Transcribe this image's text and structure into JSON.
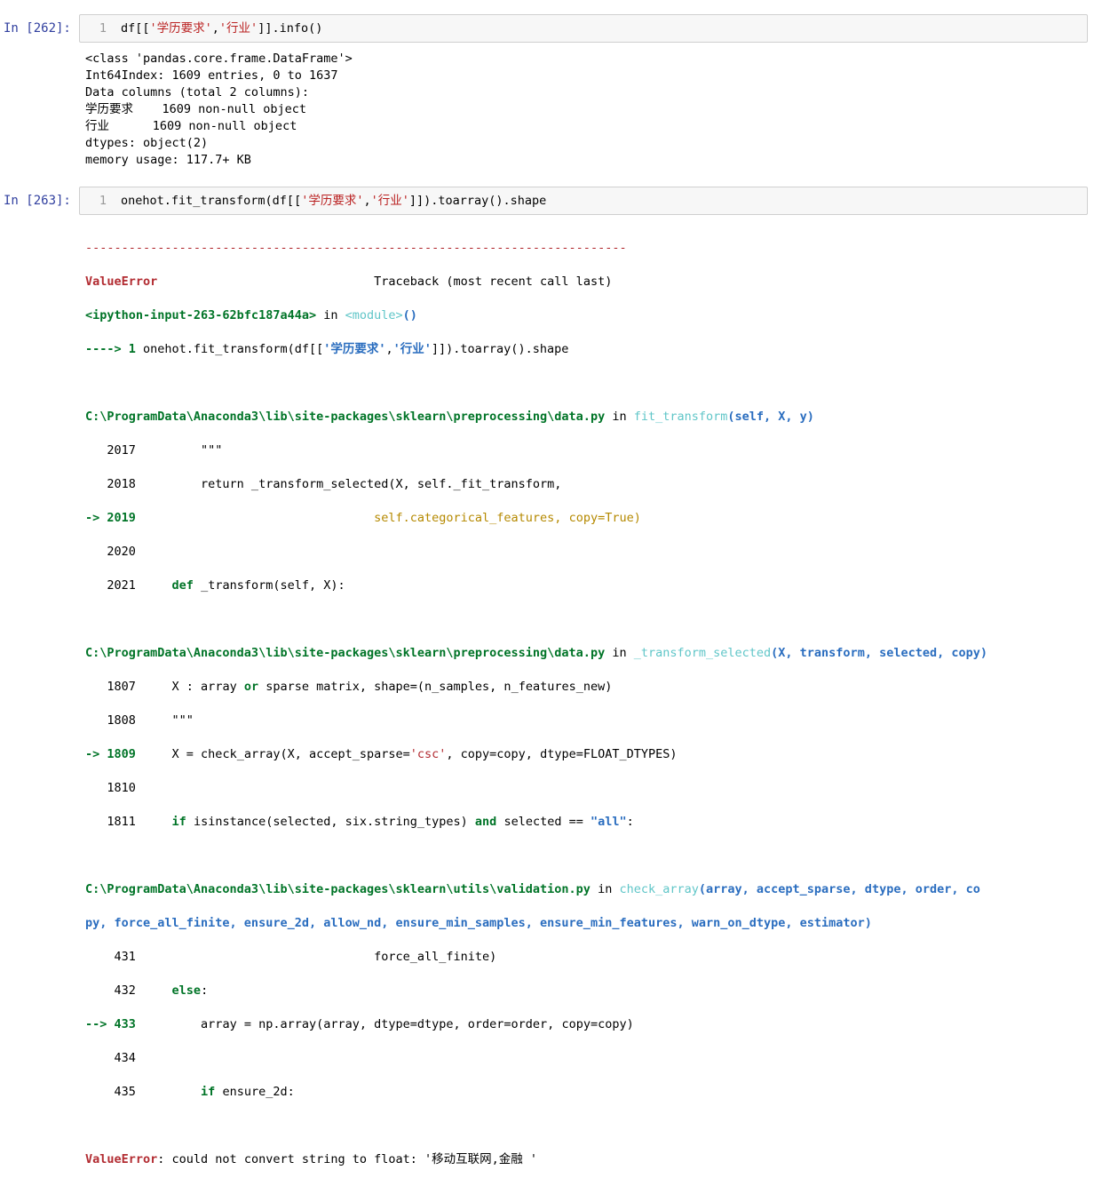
{
  "cell1": {
    "prompt": "In  [262]:",
    "lineno": "1",
    "code_pre": "df[[",
    "code_str1": "'学历要求'",
    "code_comma": ",",
    "code_str2": "'行业'",
    "code_post": "]].info()",
    "output": [
      "<class 'pandas.core.frame.DataFrame'>",
      "Int64Index: 1609 entries, 0 to 1637",
      "Data columns (total 2 columns):",
      "学历要求    1609 non-null object",
      "行业      1609 non-null object",
      "dtypes: object(2)",
      "memory usage: 117.7+ KB"
    ]
  },
  "cell2": {
    "prompt": "In  [263]:",
    "lineno": "1",
    "code_pre": "onehot.fit_transform(df[[",
    "code_str1": "'学历要求'",
    "code_comma": ",",
    "code_str2": "'行业'",
    "code_post": "]]).toarray().shape"
  },
  "traceback": {
    "dashes": "---------------------------------------------------------------------------",
    "error_name": "ValueError",
    "traceback_header": "                              Traceback (most recent call last)",
    "input_ref": "<ipython-input-263-62bfc187a44a>",
    "in_word": " in ",
    "module": "<module>",
    "parens": "()",
    "arrow1": "----> 1 ",
    "line1_pre": "onehot.fit_transform(df[[",
    "line1_str1": "'学历要求'",
    "line1_comma": ",",
    "line1_str2": "'行业'",
    "line1_post": "]]).toarray().shape",
    "f1_path": "C:\\ProgramData\\Anaconda3\\lib\\site-packages\\sklearn\\preprocessing\\data.py",
    "f1_func": "fit_transform",
    "f1_args": "(self, X, y)",
    "f1_l2017": "   2017         \"\"\"",
    "f1_l2018": "   2018         return _transform_selected(X, self._fit_transform,",
    "f1_arrow": "-> 2019",
    "f1_l2019": "                                 self.categorical_features, copy=True)",
    "f1_l2020": "   2020",
    "f1_l2021_no": "   2021     ",
    "f1_l2021_kw": "def",
    "f1_l2021_rest": " _transform(self, X):",
    "f2_path": "C:\\ProgramData\\Anaconda3\\lib\\site-packages\\sklearn\\preprocessing\\data.py",
    "f2_func": "_transform_selected",
    "f2_args": "(X, transform, selected, copy)",
    "f2_l1807_no": "   1807     ",
    "f2_l1807_a": "X : array ",
    "f2_l1807_kw": "or",
    "f2_l1807_b": " sparse matrix, shape=(n_samples, n_features_new)",
    "f2_l1808": "   1808     \"\"\"",
    "f2_arrow": "-> 1809",
    "f2_l1809_a": "     X = check_array(X, accept_sparse=",
    "f2_l1809_str": "'csc'",
    "f2_l1809_b": ", copy=copy, dtype=FLOAT_DTYPES)",
    "f2_l1810": "   1810",
    "f2_l1811_no": "   1811     ",
    "f2_l1811_kw1": "if",
    "f2_l1811_a": " isinstance(selected, six.string_types) ",
    "f2_l1811_kw2": "and",
    "f2_l1811_b": " selected == ",
    "f2_l1811_str": "\"all\"",
    "f2_l1811_c": ":",
    "f3_path": "C:\\ProgramData\\Anaconda3\\lib\\site-packages\\sklearn\\utils\\validation.py",
    "f3_func": "check_array",
    "f3_args1": "(array, accept_sparse, dtype, order, co",
    "f3_args2": "py, force_all_finite, ensure_2d, allow_nd, ensure_min_samples, ensure_min_features, warn_on_dtype, estimator)",
    "f3_l431": "    431                                 force_all_finite)",
    "f3_l432_no": "    432     ",
    "f3_l432_kw": "else",
    "f3_l432_rest": ":",
    "f3_arrow": "--> 433",
    "f3_l433": "         array = np.array(array, dtype=dtype, order=order, copy=copy)",
    "f3_l434": "    434",
    "f3_l435_no": "    435         ",
    "f3_l435_kw": "if",
    "f3_l435_rest": " ensure_2d:",
    "final_error": "ValueError",
    "final_msg": ": could not convert string to float: '移动互联网,金融 '"
  }
}
